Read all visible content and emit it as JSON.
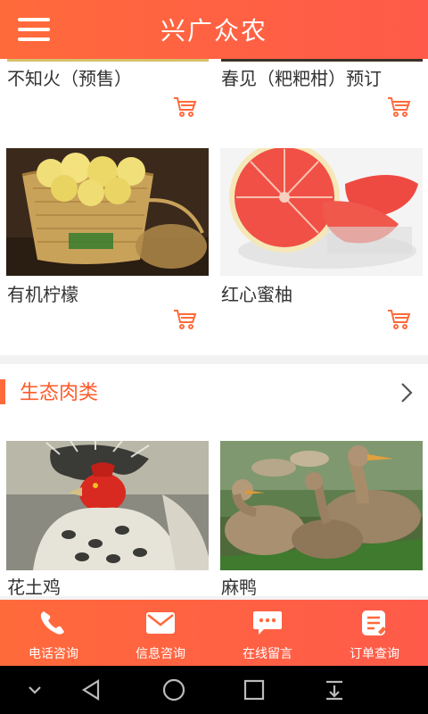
{
  "header": {
    "title": "兴广众农",
    "menu_icon": "menu-icon"
  },
  "top_row": [
    {
      "name": "不知火（预售）"
    },
    {
      "name": "春见（粑粑柑）预订"
    }
  ],
  "fruit_row": [
    {
      "name": "有机柠檬",
      "image": "lemons-in-basket"
    },
    {
      "name": "红心蜜柚",
      "image": "red-grapefruit"
    }
  ],
  "meat_section": {
    "title": "生态肉类",
    "items": [
      {
        "name": "花土鸡",
        "image": "rooster"
      },
      {
        "name": "麻鸭",
        "image": "ducks"
      }
    ]
  },
  "tabbar": {
    "tabs": [
      {
        "label": "电话咨询",
        "icon": "phone-icon"
      },
      {
        "label": "信息咨询",
        "icon": "mail-icon"
      },
      {
        "label": "在线留言",
        "icon": "chat-bubble-icon"
      },
      {
        "label": "订单查询",
        "icon": "order-list-icon"
      }
    ]
  },
  "colors": {
    "accent": "#ff6a3b",
    "section_title": "#ff5a2a",
    "text": "#333333"
  }
}
